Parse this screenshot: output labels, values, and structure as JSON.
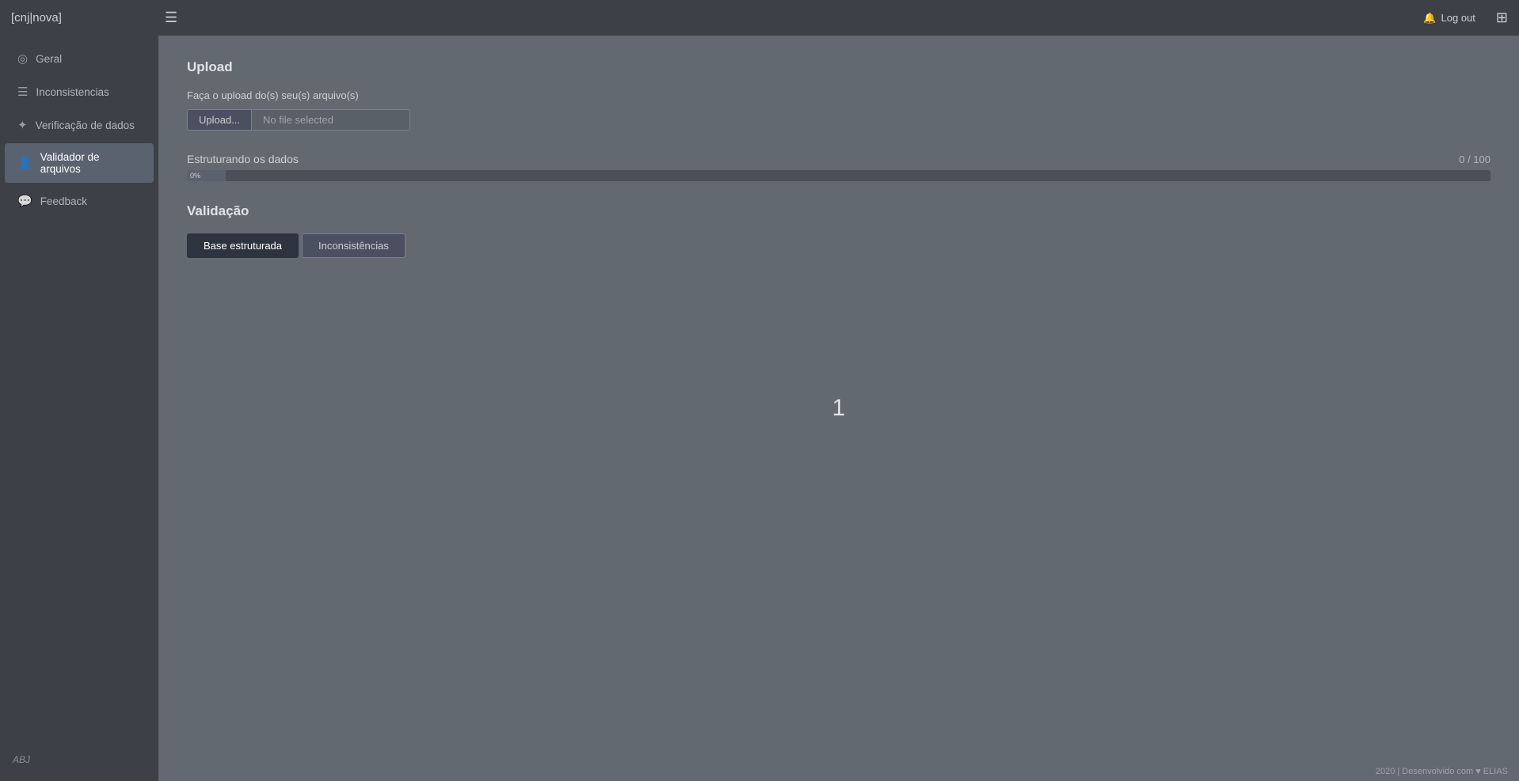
{
  "app": {
    "logo": "[cnj|nova]",
    "logout_label": "Log out",
    "grid_icon": "⊞"
  },
  "hamburger": "☰",
  "sidebar": {
    "items": [
      {
        "id": "geral",
        "label": "Geral",
        "icon": "◎",
        "active": false
      },
      {
        "id": "inconsistencias",
        "label": "Inconsistencias",
        "icon": "☰",
        "active": false
      },
      {
        "id": "verificacao",
        "label": "Verificação de dados",
        "icon": "✦",
        "active": false
      },
      {
        "id": "validador",
        "label": "Validador de arquivos",
        "icon": "👤",
        "active": true
      },
      {
        "id": "feedback",
        "label": "Feedback",
        "icon": "💬",
        "active": false
      }
    ],
    "abj_label": "ABJ"
  },
  "main": {
    "upload_section": {
      "title": "Upload",
      "label": "Faça o upload do(s) seu(s) arquivo(s)",
      "upload_btn": "Upload...",
      "file_placeholder": "No file selected"
    },
    "progress_section": {
      "title": "Estruturando os dados",
      "count": "0 / 100",
      "percent": "0%",
      "fill_width": "3%"
    },
    "validacao_section": {
      "title": "Validação",
      "tabs": [
        {
          "label": "Base estruturada",
          "active": true
        },
        {
          "label": "Inconsistências",
          "active": false
        }
      ],
      "page_number": "1"
    }
  },
  "footer": {
    "text": "2020 | Desenvolvido com ♥ ELIAS"
  }
}
